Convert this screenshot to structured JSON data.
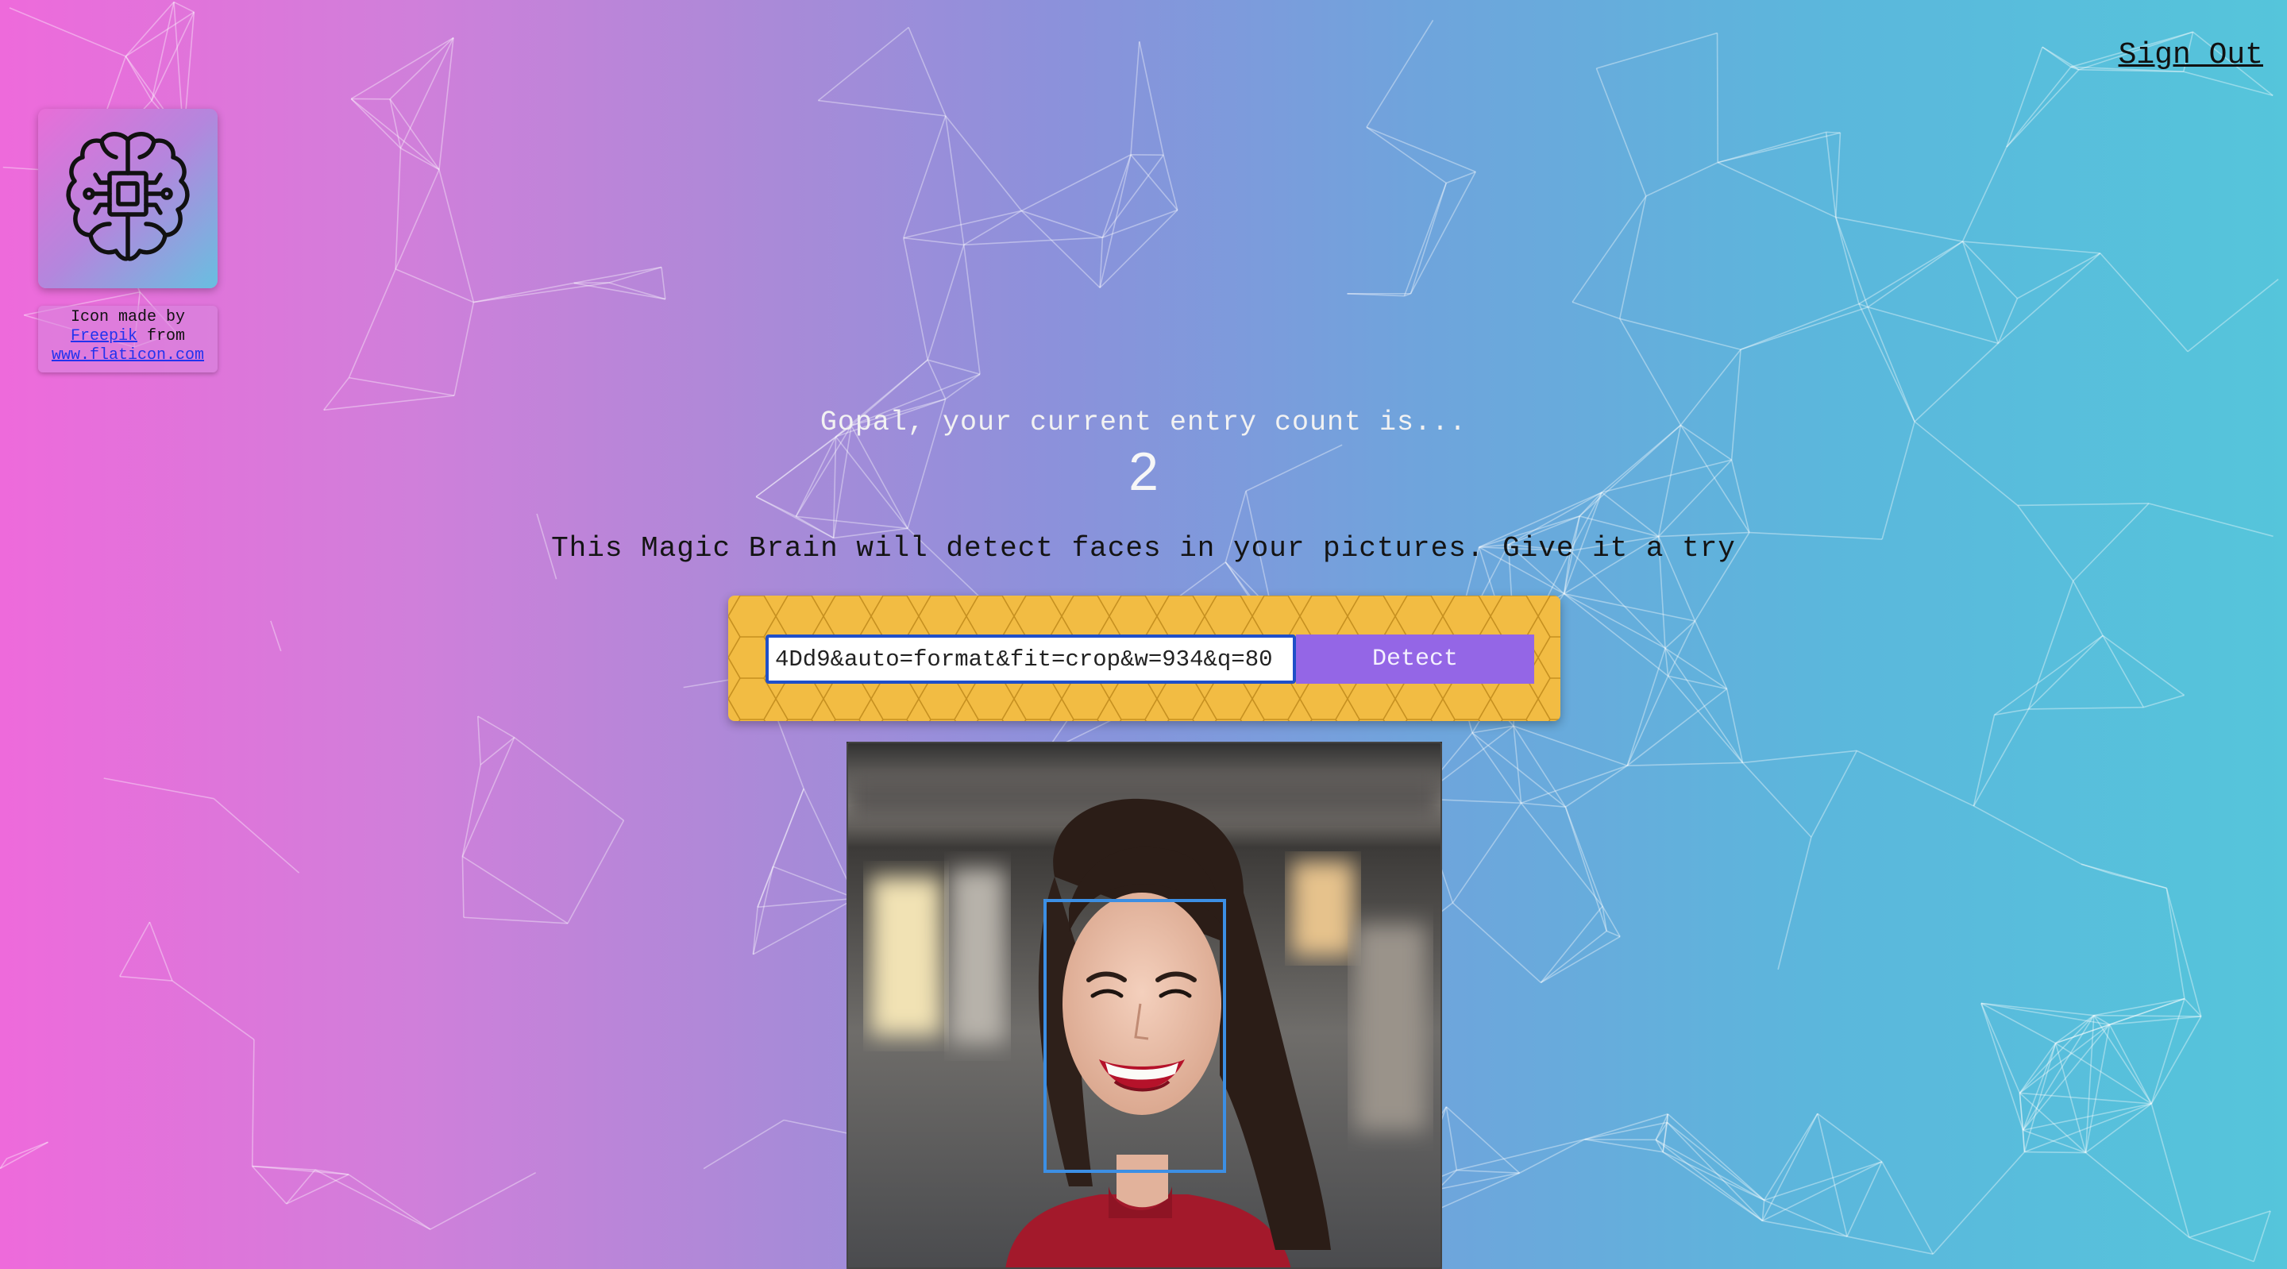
{
  "header": {
    "sign_out_label": "Sign Out"
  },
  "logo": {
    "icon": "brain-circuit-icon",
    "credit_prefix": "Icon made by",
    "credit_author": "Freepik",
    "credit_from": "from",
    "credit_site": "www.flaticon.com"
  },
  "rank": {
    "greeting": "Gopal, your current entry count is...",
    "count": "2"
  },
  "form": {
    "tagline": "This Magic Brain will detect faces in your pictures. Give it a try",
    "url_value": "4Dd9&auto=format&fit=crop&w=934&q=80",
    "detect_label": "Detect"
  },
  "result": {
    "image": "smiling-woman-photo",
    "face_box_color": "#3c8fe4"
  },
  "colors": {
    "gradient_left": "#ee6adb",
    "gradient_right": "#55c5db",
    "form_background": "#f2bc43",
    "button_background": "#9466e6"
  }
}
